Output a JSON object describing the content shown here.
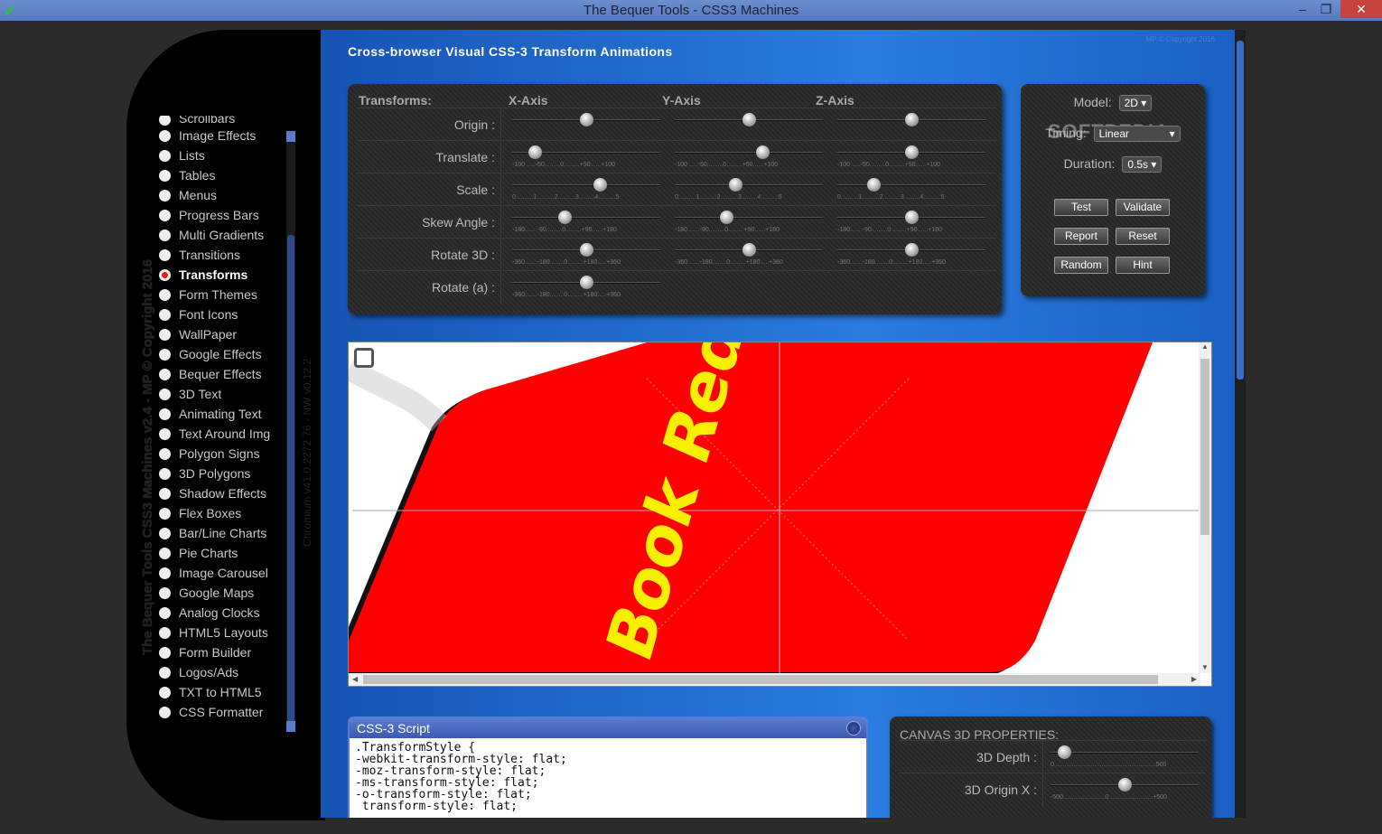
{
  "window": {
    "title": "The Bequer Tools - CSS3 Machines",
    "minimize": "–",
    "restore": "❐",
    "close": "✕"
  },
  "sidebar": {
    "vertical_title": "The Bequer Tools CSS3 Machines v2.4 - MP © Copyright 2016",
    "vertical_version": "Chromium v41.0.2272.76 - NW v0.12.2",
    "partial_item": "Scrollbars",
    "items": [
      "Image Effects",
      "Lists",
      "Tables",
      "Menus",
      "Progress Bars",
      "Multi Gradients",
      "Transitions",
      "Transforms",
      "Form Themes",
      "Font Icons",
      "WallPaper",
      "Google Effects",
      "Bequer Effects",
      "3D Text",
      "Animating Text",
      "Text Around Img",
      "Polygon Signs",
      "3D Polygons",
      "Shadow Effects",
      "Flex Boxes",
      "Bar/Line Charts",
      "Pie Charts",
      "Image Carousel",
      "Google Maps",
      "Analog Clocks",
      "HTML5 Layouts",
      "Form Builder",
      "Logos/Ads",
      "TXT to HTML5",
      "CSS Formatter"
    ],
    "selected": "Transforms"
  },
  "main": {
    "heading": "Cross-browser Visual CSS-3 Transform Animations",
    "copyright": "MP © Copyright 2016",
    "transforms": {
      "header": "Transforms:",
      "axes": [
        "X-Axis",
        "Y-Axis",
        "Z-Axis"
      ],
      "rows": [
        {
          "label": "Origin :",
          "ticks": [
            "",
            "",
            ""
          ],
          "values": [
            0.5,
            0.5,
            0.5
          ]
        },
        {
          "label": "Translate :",
          "ticks": [
            "-100 .....-50.........0.........+50......+100",
            "-100 .....-50.........0.........+50......+100",
            "-100 .....-50.........0.........+50......+100"
          ],
          "values": [
            0.12,
            0.6,
            0.5
          ]
        },
        {
          "label": "Scale :",
          "ticks": [
            "0..........1..........2..........3.........4..........5",
            "0..........1..........2..........3.........4..........5",
            "0..........1..........2..........3.........4..........5"
          ],
          "values": [
            0.6,
            0.4,
            0.22
          ]
        },
        {
          "label": "Skew Angle :",
          "ticks": [
            "-180.......-90.........0.........+90......+180",
            "-180.......-90.........0.........+90......+180",
            "-180.......-90.........0.........+90......+180"
          ],
          "values": [
            0.34,
            0.33,
            0.5
          ]
        },
        {
          "label": "Rotate 3D :",
          "ticks": [
            "-360.......-180........0.........+180.....+360",
            "-360.......-180........0.........+180.....+360",
            "-360.......-180........0.........+180.....+360"
          ],
          "values": [
            0.5,
            0.5,
            0.5
          ]
        },
        {
          "label": "Rotate (a) :",
          "ticks": [
            "-360.......-180........0.........+180.....+360"
          ],
          "values": [
            0.5
          ]
        }
      ]
    },
    "model": {
      "model_label": "Model:",
      "model_value": "2D",
      "timing_label": "Timing:",
      "timing_value": "Linear",
      "duration_label": "Duration:",
      "duration_value": "0.5s",
      "watermark": "SOFTPEDIA",
      "buttons": [
        "Test",
        "Validate",
        "Report",
        "Reset",
        "Random",
        "Hint"
      ]
    },
    "preview": {
      "text": "Book Red Title",
      "arrow_up": "▲",
      "arrow_down": "▼",
      "arrow_left": "◀",
      "arrow_right": "▶"
    },
    "script": {
      "title": "CSS-3 Script",
      "code": ".TransformStyle {\n-webkit-transform-style: flat;\n-moz-transform-style: flat;\n-ms-transform-style: flat;\n-o-transform-style: flat;\n transform-style: flat;"
    },
    "canvas": {
      "title": "CANVAS 3D PROPERTIES:",
      "rows": [
        {
          "label": "3D Depth :",
          "ticks": "0..........................................................500",
          "value": 0.05
        },
        {
          "label": "3D Origin X :",
          "ticks": "-500........................0.........................+500",
          "value": 0.5
        }
      ]
    }
  },
  "colors": {
    "accent": "#2a7de0",
    "card": "#ff0000",
    "card_text": "#f8f000",
    "selected_dot": "#e02020"
  }
}
